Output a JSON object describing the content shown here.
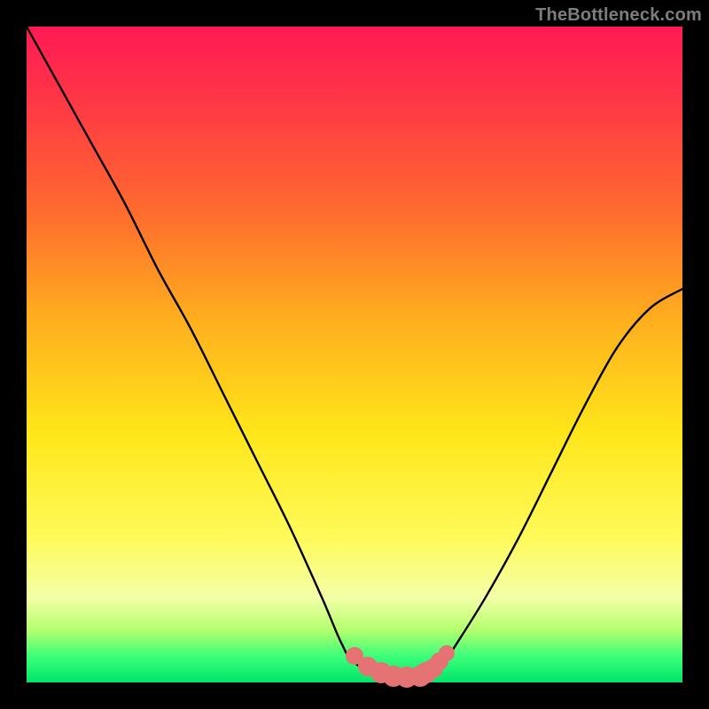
{
  "watermark": "TheBottleneck.com",
  "chart_data": {
    "type": "line",
    "title": "",
    "xlabel": "",
    "ylabel": "",
    "xlim": [
      0,
      100
    ],
    "ylim": [
      0,
      100
    ],
    "series": [
      {
        "name": "curve",
        "x": [
          0,
          5,
          10,
          15,
          20,
          25,
          30,
          35,
          40,
          45,
          48,
          50,
          55,
          60,
          63,
          65,
          70,
          75,
          80,
          85,
          90,
          95,
          100
        ],
        "y": [
          100,
          91,
          82,
          73,
          63,
          54,
          44,
          34,
          24,
          13,
          6,
          3,
          0.5,
          0.5,
          2,
          5,
          13,
          22,
          32,
          42,
          51,
          57,
          60
        ]
      }
    ],
    "worm": {
      "note": "pink clustered dots near curve minimum",
      "x": [
        50,
        52,
        54,
        56,
        58,
        60,
        61,
        62,
        63,
        64
      ],
      "y": [
        4,
        2.5,
        1.5,
        1,
        0.8,
        1,
        1.5,
        2.2,
        3.2,
        4.5
      ],
      "radius_px": [
        10,
        11,
        12,
        12,
        12,
        12,
        12,
        11,
        10,
        9
      ],
      "color": "#e57373"
    },
    "gradient_stops": [
      {
        "offset": 0.0,
        "color": "#ff1a53"
      },
      {
        "offset": 0.1,
        "color": "#ff3348"
      },
      {
        "offset": 0.28,
        "color": "#ff6a2e"
      },
      {
        "offset": 0.45,
        "color": "#ffb01e"
      },
      {
        "offset": 0.62,
        "color": "#ffe61a"
      },
      {
        "offset": 0.78,
        "color": "#fffb5a"
      },
      {
        "offset": 0.87,
        "color": "#f4ffa8"
      },
      {
        "offset": 0.92,
        "color": "#b4ff6e"
      },
      {
        "offset": 0.96,
        "color": "#3cff7a"
      },
      {
        "offset": 1.0,
        "color": "#00e56a"
      }
    ]
  }
}
